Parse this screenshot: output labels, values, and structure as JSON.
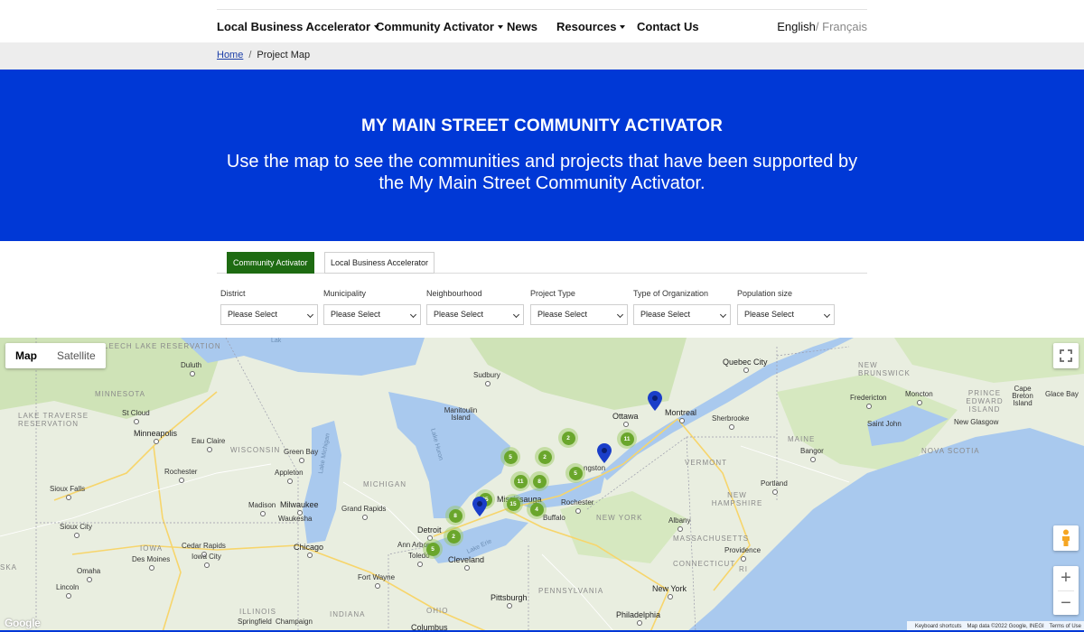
{
  "nav": {
    "items": [
      {
        "label": "Local Business Accelerator",
        "dropdown": true
      },
      {
        "label": "Community Activator",
        "dropdown": true
      },
      {
        "label": "News",
        "dropdown": false
      },
      {
        "label": "Resources",
        "dropdown": true
      },
      {
        "label": "Contact Us",
        "dropdown": false
      }
    ],
    "lang_current": "English",
    "lang_sep": "/ ",
    "lang_other": "Français"
  },
  "breadcrumb": {
    "home": "Home",
    "sep": "/",
    "current": "Project Map"
  },
  "hero": {
    "title": "MY MAIN STREET COMMUNITY ACTIVATOR",
    "subtitle": "Use the map to see the communities and projects that have been supported by the My Main Street Community Activator."
  },
  "tabs": [
    {
      "label": "Community Activator",
      "active": true
    },
    {
      "label": "Local Business Accelerator",
      "active": false
    }
  ],
  "filters": [
    {
      "label": "District",
      "value": "Please Select"
    },
    {
      "label": "Municipality",
      "value": "Please Select"
    },
    {
      "label": "Neighbourhood",
      "value": "Please Select"
    },
    {
      "label": "Project Type",
      "value": "Please Select"
    },
    {
      "label": "Type of Organization",
      "value": "Please Select"
    },
    {
      "label": "Population size",
      "value": "Please Select"
    }
  ],
  "map": {
    "type_map": "Map",
    "type_satellite": "Satellite",
    "labels": {
      "quebec_city": "Quebec City",
      "new_brunswick": "NEW BRUNSWICK",
      "duluth": "Duluth",
      "minnesota": "MINNESOTA",
      "lake_traverse": "LAKE TRAVERSE RESERVATION",
      "leech_lake": "LEECH LAKE RESERVATION",
      "st_cloud": "St Cloud",
      "minneapolis": "Minneapolis",
      "eau_claire": "Eau Claire",
      "rochester_mn": "Rochester",
      "sioux_falls": "Sioux Falls",
      "sioux_city": "Sioux City",
      "iowa": "IOWA",
      "des_moines": "Des Moines",
      "cedar_rapids": "Cedar Rapids",
      "iowa_city": "Iowa City",
      "omaha": "Omaha",
      "lincoln": "Lincoln",
      "ska": "SKA",
      "wisconsin": "WISCONSIN",
      "green_bay": "Green Bay",
      "appleton": "Appleton",
      "madison": "Madison",
      "milwaukee": "Milwaukee",
      "waukesha": "Waukesha",
      "chicago": "Chicago",
      "illinois": "ILLINOIS",
      "springfield": "Springfield",
      "champaign": "Champaign",
      "indiana": "INDIANA",
      "fort_wayne": "Fort Wayne",
      "michigan": "MICHIGAN",
      "grand_rapids": "Grand Rapids",
      "detroit": "Detroit",
      "ann_arbor": "Ann Arbor",
      "toledo": "Toledo",
      "cleveland": "Cleveland",
      "ohio": "OHIO",
      "columbus": "Columbus",
      "pittsburgh": "Pittsburgh",
      "pennsylvania": "PENNSYLVANIA",
      "sudbury": "Sudbury",
      "manitoulin": "Manitoulin Island",
      "ottawa": "Ottawa",
      "montreal": "Montreal",
      "sherbrooke": "Sherbrooke",
      "kingston": "ngston",
      "mississauga": "Mississauga",
      "rochester_ny": "Rochester",
      "buffalo": "Buffalo",
      "new_york_state": "NEW YORK",
      "albany": "Albany",
      "vermont": "VERMONT",
      "new_hampshire": "NEW HAMPSHIRE",
      "massachusetts": "MASSACHUSETTS",
      "providence": "Providence",
      "connecticut": "CONNECTICUT",
      "ri": "RI",
      "new_york_city": "New York",
      "philadelphia": "Philadelphia",
      "maine": "MAINE",
      "bangor": "Bangor",
      "portland": "Portland",
      "fredericton": "Fredericton",
      "moncton": "Moncton",
      "saint_john": "Saint John",
      "pei": "PRINCE EDWARD ISLAND",
      "nova_scotia": "NOVA SCOTIA",
      "new_glasgow": "New Glasgow",
      "cape_breton": "Cape Breton Island",
      "glace_bay": "Glace Bay",
      "lake_michigan": "Lake Michigan",
      "lake_huron": "Lake Huron",
      "lake_erie": "Lake Erie",
      "lake_sup": "Lak"
    },
    "clusters": [
      "2",
      "11",
      "5",
      "2",
      "5",
      "11",
      "8",
      "25",
      "15",
      "4",
      "8",
      "2",
      "5"
    ],
    "google": "Google",
    "attribution": {
      "shortcuts": "Keyboard shortcuts",
      "data": "Map data ©2022 Google, INEGI",
      "terms": "Terms of Use"
    },
    "zoom_in": "+",
    "zoom_out": "−"
  }
}
